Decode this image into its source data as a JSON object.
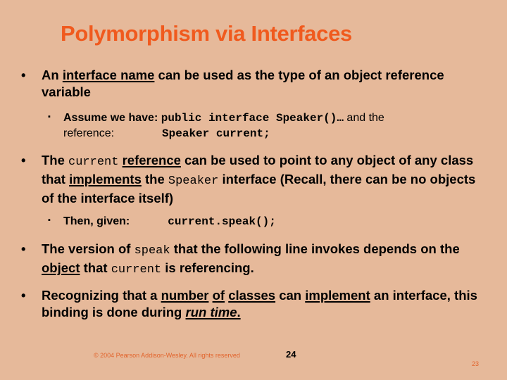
{
  "slide": {
    "title": "Polymorphism via Interfaces",
    "bullet_glyph": "•",
    "sub_bullet_glyph": "▪",
    "b1": {
      "t1": "An ",
      "u1": "interface name",
      "t2": " can be used as the type of an object reference variable"
    },
    "s1": {
      "t1": "Assume we have: ",
      "code1": "public interface Speaker()…",
      "t2": "   and the",
      "t3": "reference:",
      "code2": "Speaker current;"
    },
    "b2": {
      "t1": "The ",
      "code1": "current",
      "t2": " ",
      "u1": "reference",
      "t3": " can be used to point to any object of any class that ",
      "u2": "implements",
      "t4": " the ",
      "code2": "Speaker",
      "t5": " interface (Recall, there can be no objects of the interface itself)"
    },
    "s2": {
      "t1": "Then, given:",
      "code1": "current.speak();"
    },
    "b3": {
      "t1": "The version of ",
      "code1": "speak",
      "t2": " that the following line invokes depends on the ",
      "u1": "object",
      "t3": " that ",
      "code2": "current",
      "t4": " is referencing."
    },
    "b4": {
      "t1": "Recognizing that a ",
      "u1": "number",
      "t2": " ",
      "u2": "of",
      "t3": " ",
      "u3": "classes",
      "t4": " can ",
      "u4": "implement",
      "t5": " an interface, this binding is done during ",
      "u5": "run time",
      "t6": "."
    }
  },
  "footer": {
    "copyright": "© 2004 Pearson Addison-Wesley. All rights reserved",
    "book_page": "24",
    "slide_number": "23"
  },
  "colors": {
    "background": "#E6B99A",
    "title": "#F05A1E",
    "footer_text": "#E2632B"
  }
}
